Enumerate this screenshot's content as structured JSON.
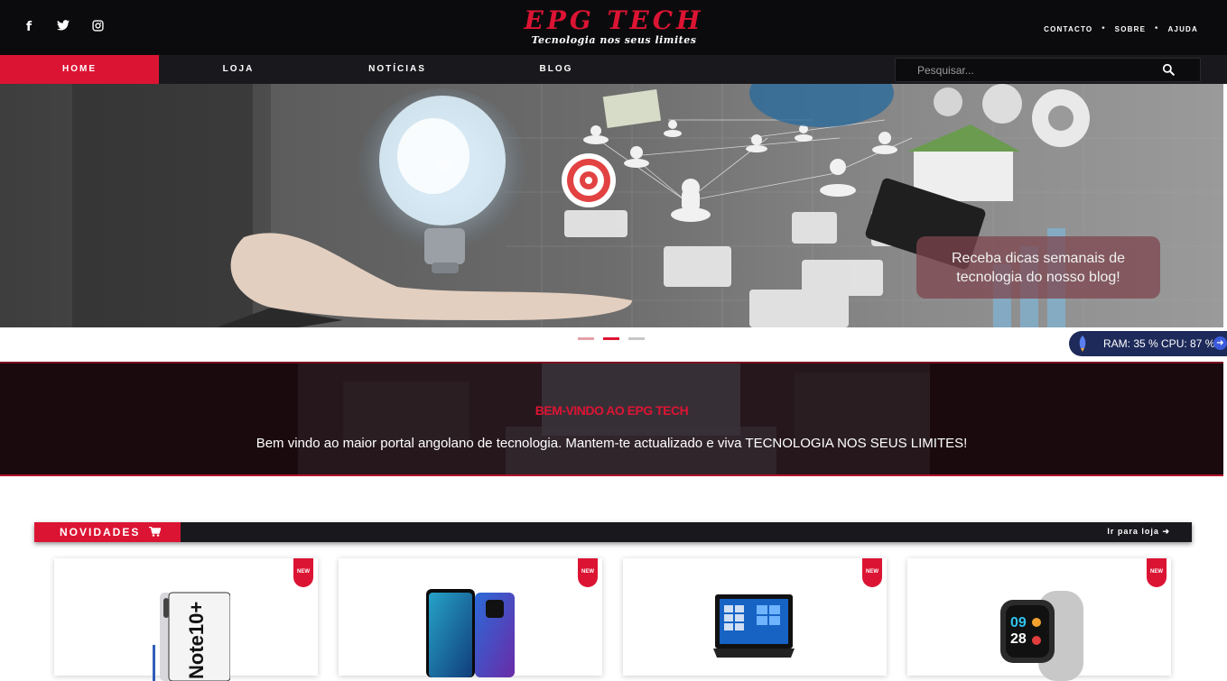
{
  "header": {
    "brand_title": "EPG TECH",
    "brand_subtitle": "Tecnologia nos seus limites",
    "social": [
      {
        "icon": "facebook-icon",
        "glyph": "f"
      },
      {
        "icon": "twitter-icon",
        "glyph": "t"
      },
      {
        "icon": "instagram-icon",
        "glyph": "◎"
      }
    ],
    "top_links": [
      "CONTACTO",
      "*",
      "SOBRE",
      "*",
      "AJUDA"
    ]
  },
  "nav": {
    "items": [
      "HOME",
      "LOJA",
      "NOTÍCIAS",
      "BLOG"
    ],
    "active": "HOME",
    "search_placeholder": "Pesquisar..."
  },
  "hero": {
    "caption_line1": "Receba dicas semanais de",
    "caption_line2": "tecnologia do nosso blog!",
    "active_dot": 2
  },
  "perf_widget": {
    "text": "RAM: 35 % CPU: 87 %"
  },
  "welcome": {
    "title": "BEM-VINDO AO EPG TECH",
    "text": "Bem vindo ao maior portal angolano de tecnologia. Mantem-te actualizado e viva TECNOLOGIA NOS SEUS LIMITES!"
  },
  "section": {
    "title": "NOVIDADES",
    "link": "Ir para loja"
  },
  "products": [
    {
      "badge": "NEW",
      "image": "smartphone-note10-image"
    },
    {
      "badge": "NEW",
      "image": "smartphone-mate20-image"
    },
    {
      "badge": "NEW",
      "image": "laptop-image"
    },
    {
      "badge": "NEW",
      "image": "smartwatch-image"
    }
  ],
  "colors": {
    "accent": "#dc1433",
    "dark": "#0b0b0d",
    "nav": "#19191d"
  }
}
